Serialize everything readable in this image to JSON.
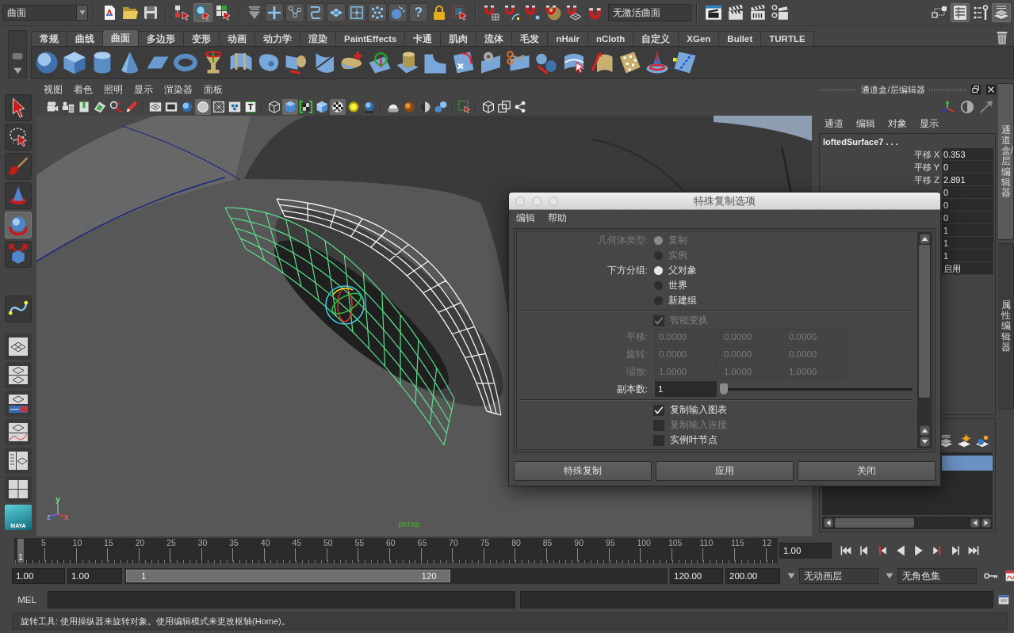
{
  "status_line": {
    "menu_set": "曲面",
    "selection_modes": [
      {
        "selected": false
      },
      {
        "selected": true
      },
      {
        "selected": false
      }
    ],
    "mask_glyph": "?",
    "live_surface": "无激活曲面",
    "panel_toggles": [
      {
        "selected": false
      },
      {
        "selected": true
      },
      {
        "selected": false
      },
      {
        "selected": true
      }
    ]
  },
  "shelf": {
    "tabs": [
      {
        "label": "常规",
        "selected": false
      },
      {
        "label": "曲线",
        "selected": false
      },
      {
        "label": "曲面",
        "selected": true
      },
      {
        "label": "多边形",
        "selected": false
      },
      {
        "label": "变形",
        "selected": false
      },
      {
        "label": "动画",
        "selected": false
      },
      {
        "label": "动力学",
        "selected": false
      },
      {
        "label": "渲染",
        "selected": false
      },
      {
        "label": "PaintEffects",
        "selected": false
      },
      {
        "label": "卡通",
        "selected": false
      },
      {
        "label": "肌肉",
        "selected": false
      },
      {
        "label": "流体",
        "selected": false
      },
      {
        "label": "毛发",
        "selected": false
      },
      {
        "label": "nHair",
        "selected": false
      },
      {
        "label": "nCloth",
        "selected": false
      },
      {
        "label": "自定义",
        "selected": false
      },
      {
        "label": "XGen",
        "selected": false
      },
      {
        "label": "Bullet",
        "selected": false
      },
      {
        "label": "TURTLE",
        "selected": false
      }
    ]
  },
  "toolbox": {
    "tools": [
      {
        "selected": false
      },
      {
        "selected": false
      },
      {
        "selected": false
      },
      {
        "selected": false
      },
      {
        "selected": true
      },
      {
        "selected": false
      },
      {
        "selected": false
      }
    ],
    "logo_text": "MAYA"
  },
  "viewport": {
    "menus": [
      "视图",
      "着色",
      "照明",
      "显示",
      "渲染器",
      "面板"
    ],
    "toolbar": [
      {
        "selected": false
      },
      {
        "selected": false
      },
      {
        "selected": false
      },
      {
        "selected": false
      },
      {
        "selected": false
      },
      {
        "selected": false
      },
      {
        "selected": false
      },
      {
        "selected": false
      },
      {
        "selected": false
      },
      {
        "selected": true
      },
      {
        "selected": false
      },
      {
        "selected": false
      },
      {
        "selected": false,
        "glyph": "T"
      },
      {
        "selected": false
      },
      {
        "selected": true
      },
      {
        "selected": false
      },
      {
        "selected": false
      },
      {
        "selected": true
      },
      {
        "selected": false
      },
      {
        "selected": false
      },
      {
        "selected": false
      },
      {
        "selected": false
      },
      {
        "selected": false
      },
      {
        "selected": false
      },
      {
        "selected": false
      },
      {
        "selected": false
      },
      {
        "selected": false
      },
      {
        "selected": false
      }
    ],
    "axis_labels": [
      "y",
      "x",
      "z"
    ],
    "camera": "persp"
  },
  "channel_box": {
    "title": "通道盒/层编辑器",
    "menus": [
      "通道",
      "编辑",
      "对象",
      "显示"
    ],
    "object": "loftedSurface7 . . .",
    "channels": [
      {
        "label": "平移 X",
        "value": "0.353"
      },
      {
        "label": "平移 Y",
        "value": "0"
      },
      {
        "label": "平移 Z",
        "value": "2.891"
      },
      {
        "value": "0"
      },
      {
        "value": "0"
      },
      {
        "value": "0"
      },
      {
        "value": "1"
      },
      {
        "value": "1"
      },
      {
        "value": "1"
      },
      {
        "value": "启用"
      }
    ],
    "layers": [
      {
        "selected": true
      }
    ],
    "side_tabs": [
      {
        "label": "通道盒/层编辑器",
        "selected": true
      },
      {
        "label": "属性编辑器",
        "selected": false
      }
    ]
  },
  "dialog": {
    "title": "特殊复制选项",
    "menus": [
      "编辑",
      "帮助"
    ],
    "rows": [
      {
        "kind": "radio",
        "label": "几何体类型:",
        "disabled": true,
        "options": [
          {
            "label": "复制",
            "selected": true
          },
          {
            "label": "实例",
            "selected": false
          }
        ]
      },
      {
        "kind": "radio",
        "label": "下方分组:",
        "disabled": false,
        "options": [
          {
            "label": "父对象",
            "selected": true
          },
          {
            "label": "世界",
            "selected": false
          },
          {
            "label": "新建组",
            "selected": false
          }
        ]
      },
      {
        "kind": "divider"
      },
      {
        "kind": "checkbox",
        "label": "智能变换",
        "checked": true,
        "disabled": true
      },
      {
        "kind": "vector",
        "label": "平移:",
        "disabled": true,
        "values": [
          "0.0000",
          "0.0000",
          "0.0000"
        ]
      },
      {
        "kind": "vector",
        "label": "旋转:",
        "disabled": true,
        "values": [
          "0.0000",
          "0.0000",
          "0.0000"
        ]
      },
      {
        "kind": "vector",
        "label": "缩放:",
        "disabled": true,
        "values": [
          "1.0000",
          "1.0000",
          "1.0000"
        ]
      },
      {
        "kind": "slider",
        "label": "副本数:",
        "value": "1",
        "level": 0
      },
      {
        "kind": "divider"
      },
      {
        "kind": "checkbox",
        "label": "复制输入图表",
        "checked": true,
        "disabled": false
      },
      {
        "kind": "checkbox",
        "label": "复制输入连接",
        "checked": false,
        "disabled": true
      },
      {
        "kind": "checkbox",
        "label": "实例叶节点",
        "checked": false,
        "disabled": false
      }
    ],
    "buttons": [
      "特殊复制",
      "应用",
      "关闭"
    ]
  },
  "time_slider": {
    "tick_labels": [
      "5",
      "10",
      "15",
      "20",
      "25",
      "30",
      "35",
      "40",
      "45",
      "50",
      "55",
      "60",
      "65",
      "70",
      "75",
      "80",
      "85",
      "90",
      "95",
      "100",
      "105",
      "110",
      "115",
      "12"
    ],
    "current_frame": "1",
    "current_time": "1.00"
  },
  "range_slider": {
    "start_time": "1.00",
    "range_start": "1.00",
    "min_label": "1",
    "max_label": "120",
    "level": 0.6,
    "range_end": "120.00",
    "end_time": "200.00",
    "anim_layer": "无动画层",
    "character_set": "无角色集"
  },
  "command_line": {
    "language": "MEL"
  },
  "help_line": "旋转工具: 使用操纵器来旋转对象。使用编辑模式来更改枢轴(Home)。"
}
